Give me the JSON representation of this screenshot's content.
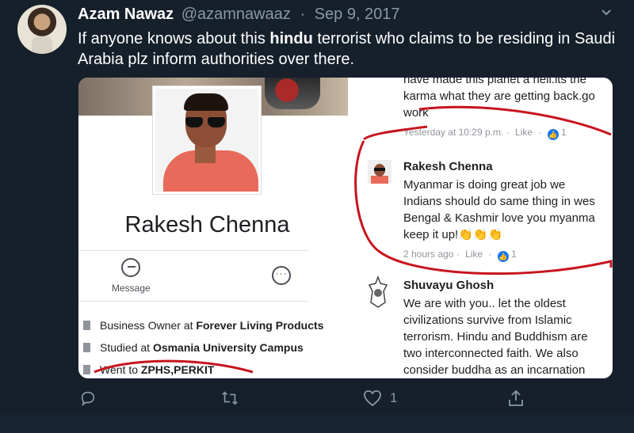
{
  "tweet": {
    "author_name": "Azam Nawaz",
    "handle": "@azamnawaaz",
    "separator": "·",
    "date": "Sep 9, 2017",
    "text_before": "If anyone knows about this ",
    "text_bold": "hindu",
    "text_after": " terrorist who claims to be residing in Saudi Arabia plz inform authorities over there."
  },
  "profile_card": {
    "name": "Rakesh Chenna",
    "message_label": "Message",
    "more_label": "···",
    "info": [
      {
        "prefix": "Business Owner at ",
        "bold": "Forever Living Products"
      },
      {
        "prefix": "Studied at ",
        "bold": "Osmania University Campus"
      },
      {
        "prefix": "Went to ",
        "bold": "ZPHS,PERKIT"
      }
    ]
  },
  "comments": {
    "top_lines": [
      "have made this planet a hell.its the",
      "karma what they are getting back.go",
      "work"
    ],
    "top_meta": {
      "time": "Yesterday at 10:29 p.m.",
      "like": "Like",
      "count": "1"
    },
    "rakesh": {
      "name": "Rakesh Chenna",
      "lines": [
        "Myanmar is doing  great job we",
        "Indians should do same thing in wes",
        "Bengal & Kashmir love you myanma",
        "keep it up!👏👏👏"
      ],
      "meta": {
        "time": "2 hours ago",
        "like": "Like",
        "count": "1"
      }
    },
    "shuvayu": {
      "name": "Shuvayu Ghosh",
      "lines": [
        "We are with you.. let the oldest",
        "civilizations survive from Islamic",
        "terrorism. Hindu and Buddhism are",
        "two interconnected faith. We also",
        "consider buddha as an incarnation"
      ]
    }
  },
  "actions": {
    "reply_icon": "reply-icon",
    "retweet_icon": "retweet-icon",
    "like_icon": "heart-icon",
    "like_count": "1",
    "share_icon": "share-icon"
  },
  "colors": {
    "background": "#15202b",
    "secondary_text": "#8899a6",
    "annotation_red": "#c8141e",
    "fb_blue": "#1877f2"
  }
}
